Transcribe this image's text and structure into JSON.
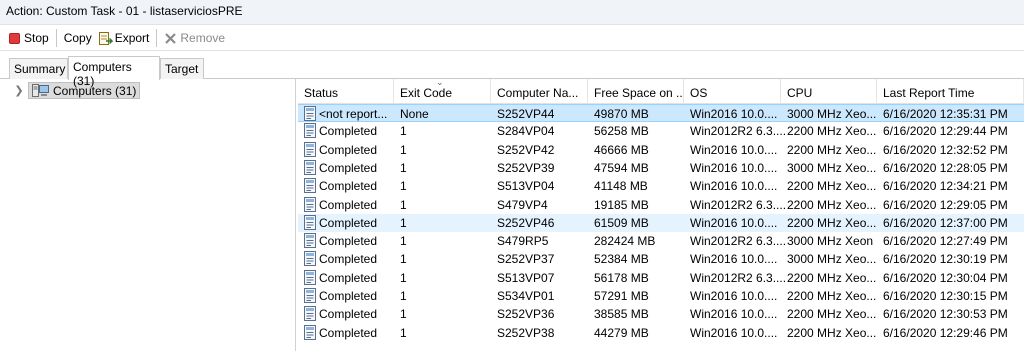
{
  "window": {
    "title": "Action: Custom Task - 01 - listaserviciosPRE"
  },
  "toolbar": {
    "stop_label": "Stop",
    "copy_label": "Copy",
    "export_label": "Export",
    "remove_label": "Remove"
  },
  "tabs": [
    {
      "label": "Summary"
    },
    {
      "label": "Computers (31)"
    },
    {
      "label": "Target"
    }
  ],
  "tree": {
    "node_label": "Computers (31)"
  },
  "columns": [
    "Status",
    "Exit Code",
    "Computer Na...",
    "Free Space on ...",
    "OS",
    "CPU",
    "Last Report Time"
  ],
  "rows": [
    {
      "status": "<not report...",
      "exit": "None",
      "computer": "S252VP44",
      "free": "49870 MB",
      "os": "Win2016 10.0....",
      "cpu": "3000 MHz Xeo...",
      "time": "6/16/2020 12:35:31 PM"
    },
    {
      "status": "Completed",
      "exit": "1",
      "computer": "S284VP04",
      "free": "56258 MB",
      "os": "Win2012R2 6.3....",
      "cpu": "2200 MHz Xeo...",
      "time": "6/16/2020 12:29:44 PM"
    },
    {
      "status": "Completed",
      "exit": "1",
      "computer": "S252VP42",
      "free": "46666 MB",
      "os": "Win2016 10.0....",
      "cpu": "2200 MHz Xeo...",
      "time": "6/16/2020 12:32:52 PM"
    },
    {
      "status": "Completed",
      "exit": "1",
      "computer": "S252VP39",
      "free": "47594 MB",
      "os": "Win2016 10.0....",
      "cpu": "3000 MHz Xeo...",
      "time": "6/16/2020 12:28:05 PM"
    },
    {
      "status": "Completed",
      "exit": "1",
      "computer": "S513VP04",
      "free": "41148 MB",
      "os": "Win2016 10.0....",
      "cpu": "2200 MHz Xeo...",
      "time": "6/16/2020 12:34:21 PM"
    },
    {
      "status": "Completed",
      "exit": "1",
      "computer": "S479VP4",
      "free": "19185 MB",
      "os": "Win2012R2 6.3....",
      "cpu": "2200 MHz Xeo...",
      "time": "6/16/2020 12:29:05 PM"
    },
    {
      "status": "Completed",
      "exit": "1",
      "computer": "S252VP46",
      "free": "61509 MB",
      "os": "Win2016 10.0....",
      "cpu": "2200 MHz Xeo...",
      "time": "6/16/2020 12:37:00 PM"
    },
    {
      "status": "Completed",
      "exit": "1",
      "computer": "S479RP5",
      "free": "282424 MB",
      "os": "Win2012R2 6.3....",
      "cpu": "3000 MHz Xeon",
      "time": "6/16/2020 12:27:49 PM"
    },
    {
      "status": "Completed",
      "exit": "1",
      "computer": "S252VP37",
      "free": "52384 MB",
      "os": "Win2016 10.0....",
      "cpu": "3000 MHz Xeo...",
      "time": "6/16/2020 12:30:19 PM"
    },
    {
      "status": "Completed",
      "exit": "1",
      "computer": "S513VP07",
      "free": "56178 MB",
      "os": "Win2012R2 6.3....",
      "cpu": "2200 MHz Xeo...",
      "time": "6/16/2020 12:30:04 PM"
    },
    {
      "status": "Completed",
      "exit": "1",
      "computer": "S534VP01",
      "free": "57291 MB",
      "os": "Win2016 10.0....",
      "cpu": "2200 MHz Xeo...",
      "time": "6/16/2020 12:30:15 PM"
    },
    {
      "status": "Completed",
      "exit": "1",
      "computer": "S252VP36",
      "free": "38585 MB",
      "os": "Win2016 10.0....",
      "cpu": "2200 MHz Xeo...",
      "time": "6/16/2020 12:30:53 PM"
    },
    {
      "status": "Completed",
      "exit": "1",
      "computer": "S252VP38",
      "free": "44279 MB",
      "os": "Win2016 10.0....",
      "cpu": "2200 MHz Xeo...",
      "time": "6/16/2020 12:29:46 PM"
    }
  ]
}
